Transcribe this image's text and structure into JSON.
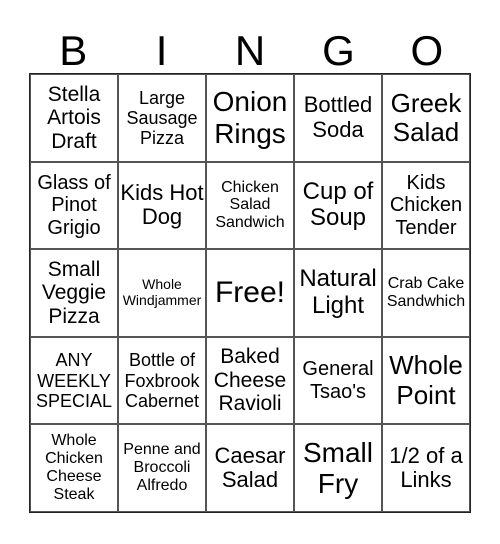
{
  "header": {
    "letters": [
      "B",
      "I",
      "N",
      "G",
      "O"
    ]
  },
  "cells": [
    [
      "Stella Artois Draft",
      "Large Sausage Pizza",
      "Onion Rings",
      "Bottled Soda",
      "Greek Salad"
    ],
    [
      "Glass of Pinot Grigio",
      "Kids Hot Dog",
      "Chicken Salad Sandwich",
      "Cup of Soup",
      "Kids Chicken Tender"
    ],
    [
      "Small Veggie Pizza",
      "Whole Windjammer",
      "Free!",
      "Natural Light",
      "Crab Cake Sandwhich"
    ],
    [
      "ANY WEEKLY SPECIAL",
      "Bottle of Foxbrook Cabernet",
      "Baked Cheese Ravioli",
      "General Tsao's",
      "Whole Point"
    ],
    [
      "Whole Chicken Cheese Steak",
      "Penne and Broccoli Alfredo",
      "Caesar Salad",
      "Small Fry",
      "1/2 of a Links"
    ]
  ]
}
